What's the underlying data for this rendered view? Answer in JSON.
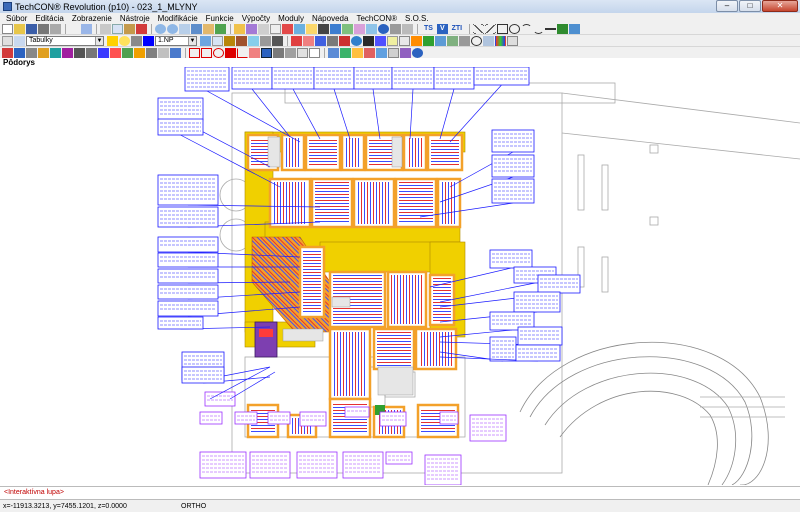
{
  "window": {
    "title": "TechCON® Revolution  (p10) - 023_1_MLYNY",
    "minimize": "–",
    "maximize": "□",
    "close": "✕"
  },
  "menu": [
    "Súbor",
    "Editácia",
    "Zobrazenie",
    "Nástroje",
    "Modifikácie",
    "Funkcie",
    "Výpočty",
    "Moduly",
    "Nápoveda",
    "TechCON®",
    "S.O.S."
  ],
  "toolbar2": {
    "table_combo": "Tabulky",
    "layer_combo": "1.NP"
  },
  "toolbar1_text": {
    "ts": "TS",
    "v": "V",
    "zti": "ZTI"
  },
  "view": {
    "title": "Pôdorys"
  },
  "command_line": "<Interaktívna lupa>",
  "status": {
    "coords": "x=-11913.3213, y=7455.1201, z=0.0000",
    "ortho": "ORTHO"
  },
  "colors": {
    "window_frame": "#c9d8ec",
    "callout": "#1a1aff",
    "callout_violet": "#9b30ff",
    "heating_red": "#e53030",
    "heating_blue": "#3a4bff",
    "fill_yellow": "#f0d000",
    "fill_orange": "#f3a12a"
  }
}
